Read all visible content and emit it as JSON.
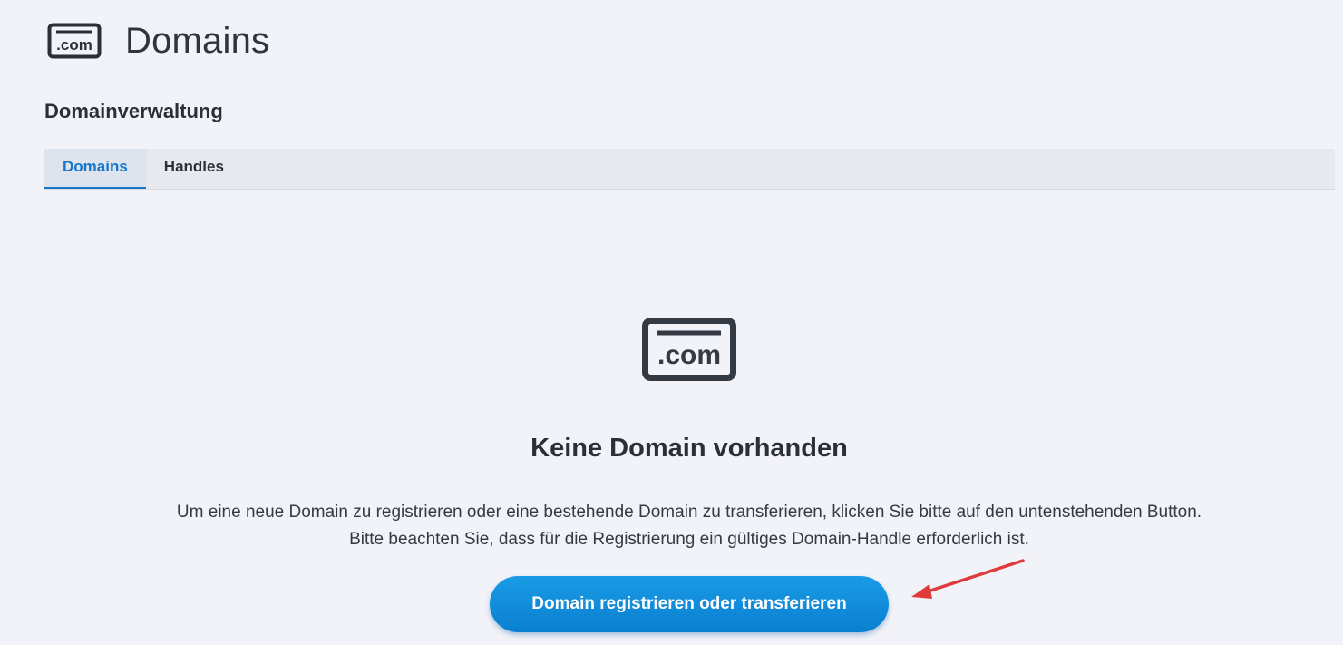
{
  "header": {
    "icon": "domain-com-icon",
    "icon_text": ".com",
    "title": "Domains"
  },
  "section": {
    "heading": "Domainverwaltung"
  },
  "tabs": [
    {
      "label": "Domains",
      "active": true
    },
    {
      "label": "Handles",
      "active": false
    }
  ],
  "empty_state": {
    "icon": "domain-com-icon",
    "icon_text": ".com",
    "title": "Keine Domain vorhanden",
    "description_lines": [
      "Um eine neue Domain zu registrieren oder eine bestehende Domain zu transferieren, klicken Sie bitte auf den untenstehenden Button.",
      "Bitte beachten Sie, dass für die Registrierung ein gültiges Domain-Handle erforderlich ist."
    ],
    "button_label": "Domain registrieren oder transferieren"
  },
  "colors": {
    "background": "#f2f3f8",
    "accent": "#1877c9",
    "button": "#0a8ad9",
    "annotation_arrow": "#e03a3a",
    "text": "#2b3038"
  }
}
